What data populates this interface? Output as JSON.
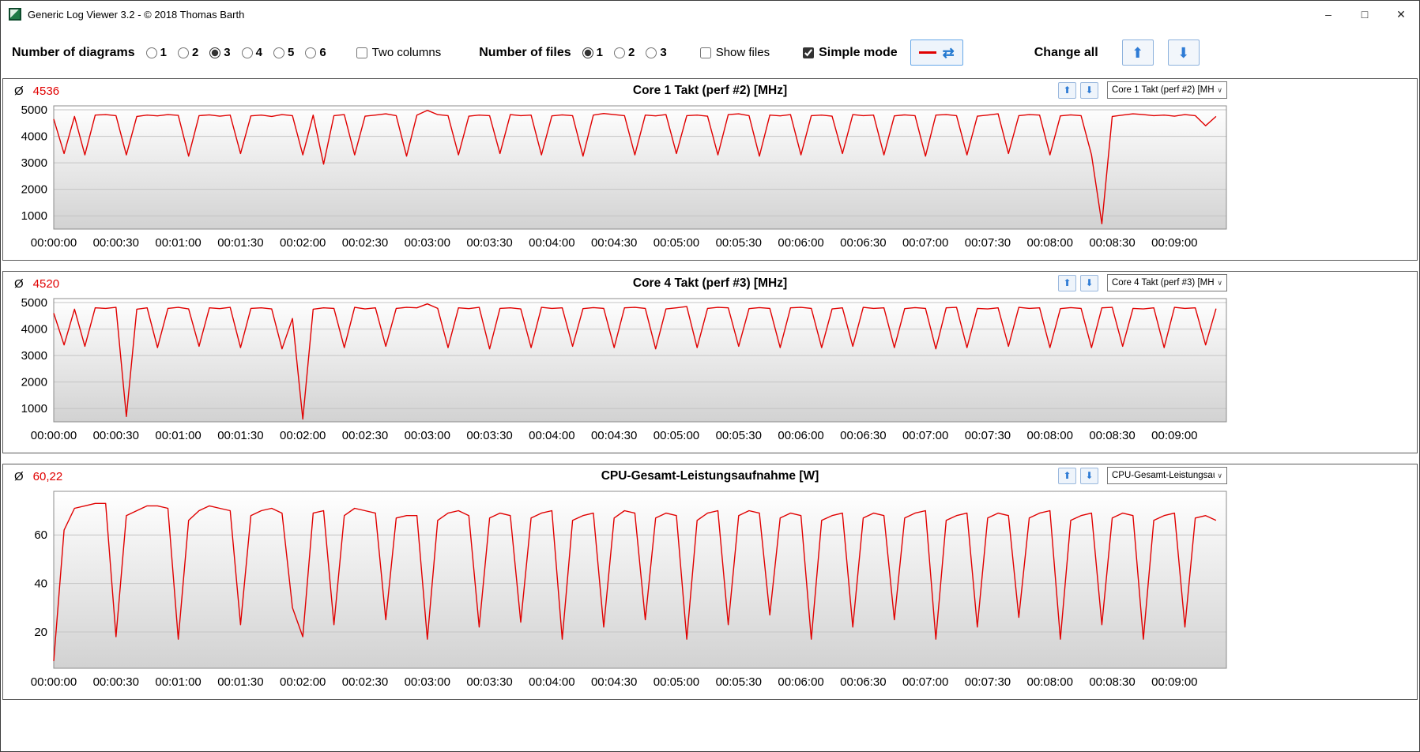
{
  "window": {
    "title": "Generic Log Viewer 3.2 - © 2018 Thomas Barth",
    "minimize_icon": "–",
    "maximize_icon": "□",
    "close_icon": "✕"
  },
  "toolbar": {
    "diagrams": {
      "label": "Number of diagrams",
      "options": [
        "1",
        "2",
        "3",
        "4",
        "5",
        "6"
      ],
      "selected": "3"
    },
    "two_columns": {
      "label": "Two columns",
      "checked": false
    },
    "files": {
      "label": "Number of files",
      "options": [
        "1",
        "2",
        "3"
      ],
      "selected": "1"
    },
    "show_files": {
      "label": "Show files",
      "checked": false
    },
    "simple_mode": {
      "label": "Simple mode",
      "checked": true
    },
    "line_color_icon": "red-dash",
    "refresh_icon": "⇄",
    "change_all": {
      "label": "Change all",
      "up_icon": "⬆",
      "down_icon": "⬇"
    }
  },
  "charts_ui": {
    "avg_symbol": "Ø",
    "up_icon": "⬆",
    "down_icon": "⬇",
    "dropdown_chevron": "∨"
  },
  "colors": {
    "line": "#e00000",
    "accent_blue": "#2e7bd5"
  },
  "chart_data": [
    {
      "type": "line",
      "title": "Core 1 Takt (perf #2) [MHz]",
      "avg": "4536",
      "dropdown_value": "Core 1 Takt (perf #2) [MH",
      "line_color": "#e00000",
      "x_step_seconds": 5,
      "xlim": [
        0,
        565
      ],
      "ylim": [
        500,
        5150
      ],
      "y_ticks": [
        1000,
        2000,
        3000,
        4000,
        5000
      ],
      "x_tick_seconds": [
        0,
        30,
        60,
        90,
        120,
        150,
        180,
        210,
        240,
        270,
        300,
        330,
        360,
        390,
        420,
        450,
        480,
        510,
        540
      ],
      "x_tick_labels": [
        "00:00:00",
        "00:00:30",
        "00:01:00",
        "00:01:30",
        "00:02:00",
        "00:02:30",
        "00:03:00",
        "00:03:30",
        "00:04:00",
        "00:04:30",
        "00:05:00",
        "00:05:30",
        "00:06:00",
        "00:06:30",
        "00:07:00",
        "00:07:30",
        "00:08:00",
        "00:08:30",
        "00:09:00"
      ],
      "values": [
        4650,
        3350,
        4750,
        3300,
        4800,
        4820,
        4780,
        3300,
        4750,
        4800,
        4770,
        4820,
        4790,
        3250,
        4780,
        4810,
        4760,
        4800,
        3350,
        4770,
        4800,
        4750,
        4820,
        4780,
        3300,
        4800,
        2950,
        4780,
        4820,
        3300,
        4760,
        4800,
        4850,
        4780,
        3250,
        4800,
        4980,
        4820,
        4780,
        3300,
        4760,
        4800,
        4780,
        3350,
        4820,
        4780,
        4800,
        3300,
        4770,
        4810,
        4780,
        3250,
        4800,
        4860,
        4820,
        4780,
        3300,
        4800,
        4770,
        4820,
        3350,
        4780,
        4800,
        4760,
        3300,
        4820,
        4850,
        4780,
        3250,
        4800,
        4770,
        4820,
        3300,
        4780,
        4800,
        4760,
        3350,
        4820,
        4780,
        4800,
        3300,
        4770,
        4810,
        4780,
        3250,
        4800,
        4820,
        4780,
        3300,
        4760,
        4800,
        4850,
        3350,
        4780,
        4820,
        4800,
        3300,
        4770,
        4810,
        4780,
        3300,
        700,
        4750,
        4800,
        4850,
        4820,
        4780,
        4800,
        4760,
        4820,
        4780,
        4400,
        4750
      ]
    },
    {
      "type": "line",
      "title": "Core 4 Takt (perf #3) [MHz]",
      "avg": "4520",
      "dropdown_value": "Core 4 Takt (perf #3) [MH",
      "line_color": "#e00000",
      "x_step_seconds": 5,
      "xlim": [
        0,
        565
      ],
      "ylim": [
        500,
        5150
      ],
      "y_ticks": [
        1000,
        2000,
        3000,
        4000,
        5000
      ],
      "x_tick_seconds": [
        0,
        30,
        60,
        90,
        120,
        150,
        180,
        210,
        240,
        270,
        300,
        330,
        360,
        390,
        420,
        450,
        480,
        510,
        540
      ],
      "x_tick_labels": [
        "00:00:00",
        "00:00:30",
        "00:01:00",
        "00:01:30",
        "00:02:00",
        "00:02:30",
        "00:03:00",
        "00:03:30",
        "00:04:00",
        "00:04:30",
        "00:05:00",
        "00:05:30",
        "00:06:00",
        "00:06:30",
        "00:07:00",
        "00:07:30",
        "00:08:00",
        "00:08:30",
        "00:09:00"
      ],
      "values": [
        4600,
        3400,
        4750,
        3350,
        4800,
        4780,
        4820,
        700,
        4750,
        4800,
        3300,
        4780,
        4820,
        4760,
        3350,
        4800,
        4770,
        4820,
        3300,
        4780,
        4800,
        4760,
        3250,
        4400,
        600,
        4750,
        4800,
        4780,
        3300,
        4820,
        4760,
        4800,
        3350,
        4780,
        4820,
        4800,
        4950,
        4780,
        3300,
        4800,
        4770,
        4820,
        3250,
        4780,
        4800,
        4760,
        3300,
        4820,
        4780,
        4800,
        3350,
        4770,
        4810,
        4780,
        3300,
        4800,
        4820,
        4780,
        3250,
        4760,
        4800,
        4850,
        3300,
        4780,
        4820,
        4800,
        3350,
        4770,
        4810,
        4780,
        3300,
        4800,
        4820,
        4780,
        3300,
        4760,
        4800,
        3350,
        4820,
        4780,
        4800,
        3300,
        4770,
        4810,
        4780,
        3250,
        4800,
        4820,
        3300,
        4780,
        4760,
        4800,
        3350,
        4820,
        4780,
        4800,
        3300,
        4770,
        4810,
        4780,
        3300,
        4800,
        4820,
        3350,
        4780,
        4760,
        4800,
        3300,
        4820,
        4780,
        4800,
        3400,
        4770
      ]
    },
    {
      "type": "line",
      "title": "CPU-Gesamt-Leistungsaufnahme [W]",
      "avg": "60,22",
      "dropdown_value": "CPU-Gesamt-Leistungsau",
      "line_color": "#e00000",
      "x_step_seconds": 5,
      "xlim": [
        0,
        565
      ],
      "ylim": [
        5,
        78
      ],
      "y_ticks": [
        20,
        40,
        60
      ],
      "x_tick_seconds": [
        0,
        30,
        60,
        90,
        120,
        150,
        180,
        210,
        240,
        270,
        300,
        330,
        360,
        390,
        420,
        450,
        480,
        510,
        540
      ],
      "x_tick_labels": [
        "00:00:00",
        "00:00:30",
        "00:01:00",
        "00:01:30",
        "00:02:00",
        "00:02:30",
        "00:03:00",
        "00:03:30",
        "00:04:00",
        "00:04:30",
        "00:05:00",
        "00:05:30",
        "00:06:00",
        "00:06:30",
        "00:07:00",
        "00:07:30",
        "00:08:00",
        "00:08:30",
        "00:09:00"
      ],
      "values": [
        8,
        62,
        71,
        72,
        73,
        73,
        18,
        68,
        70,
        72,
        72,
        71,
        17,
        66,
        70,
        72,
        71,
        70,
        23,
        68,
        70,
        71,
        69,
        30,
        18,
        69,
        70,
        23,
        68,
        71,
        70,
        69,
        25,
        67,
        68,
        68,
        17,
        66,
        69,
        70,
        68,
        22,
        67,
        69,
        68,
        24,
        67,
        69,
        70,
        17,
        66,
        68,
        69,
        22,
        67,
        70,
        69,
        25,
        67,
        69,
        68,
        17,
        66,
        69,
        70,
        23,
        68,
        70,
        69,
        27,
        67,
        69,
        68,
        17,
        66,
        68,
        69,
        22,
        67,
        69,
        68,
        25,
        67,
        69,
        70,
        17,
        66,
        68,
        69,
        22,
        67,
        69,
        68,
        26,
        67,
        69,
        70,
        17,
        66,
        68,
        69,
        23,
        67,
        69,
        68,
        17,
        66,
        68,
        69,
        22,
        67,
        68,
        66
      ]
    }
  ]
}
